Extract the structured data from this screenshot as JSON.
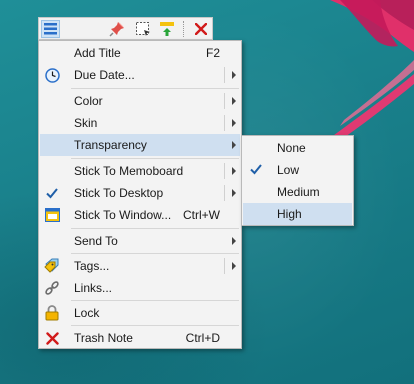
{
  "toolbar": {
    "buttons": [
      {
        "icon": "menu-lines-icon"
      },
      {
        "icon": "pin-icon"
      },
      {
        "icon": "select-marquee-icon"
      },
      {
        "icon": "roll-up-icon"
      },
      {
        "icon": "close-icon"
      }
    ]
  },
  "menu": {
    "items": [
      {
        "label": "Add Title",
        "shortcut": "F2",
        "icon": ""
      },
      {
        "label": "Due Date...",
        "icon": "clock-icon",
        "submenu": true
      },
      {
        "label": "Color",
        "submenu": true
      },
      {
        "label": "Skin",
        "submenu": true
      },
      {
        "label": "Transparency",
        "submenu": true,
        "highlighted": true
      },
      {
        "label": "Stick To Memoboard",
        "submenu": true
      },
      {
        "label": "Stick To Desktop",
        "submenu": true,
        "checked": true
      },
      {
        "label": "Stick To Window...",
        "shortcut": "Ctrl+W",
        "icon": "window-icon"
      },
      {
        "label": "Send To",
        "submenu": true
      },
      {
        "label": "Tags...",
        "icon": "tags-icon",
        "submenu": true
      },
      {
        "label": "Links...",
        "icon": "link-icon"
      },
      {
        "label": "Lock",
        "icon": "padlock-icon"
      },
      {
        "label": "Trash Note",
        "shortcut": "Ctrl+D",
        "icon": "red-x-icon"
      }
    ]
  },
  "transparency_menu": {
    "items": [
      {
        "label": "None"
      },
      {
        "label": "Low",
        "checked": true
      },
      {
        "label": "Medium"
      },
      {
        "label": "High",
        "highlighted": true
      }
    ]
  },
  "colors": {
    "desktop": "#1a8290",
    "flower": "#e0306a",
    "highlight": "#cfdff0",
    "close": "#d11a1a"
  }
}
